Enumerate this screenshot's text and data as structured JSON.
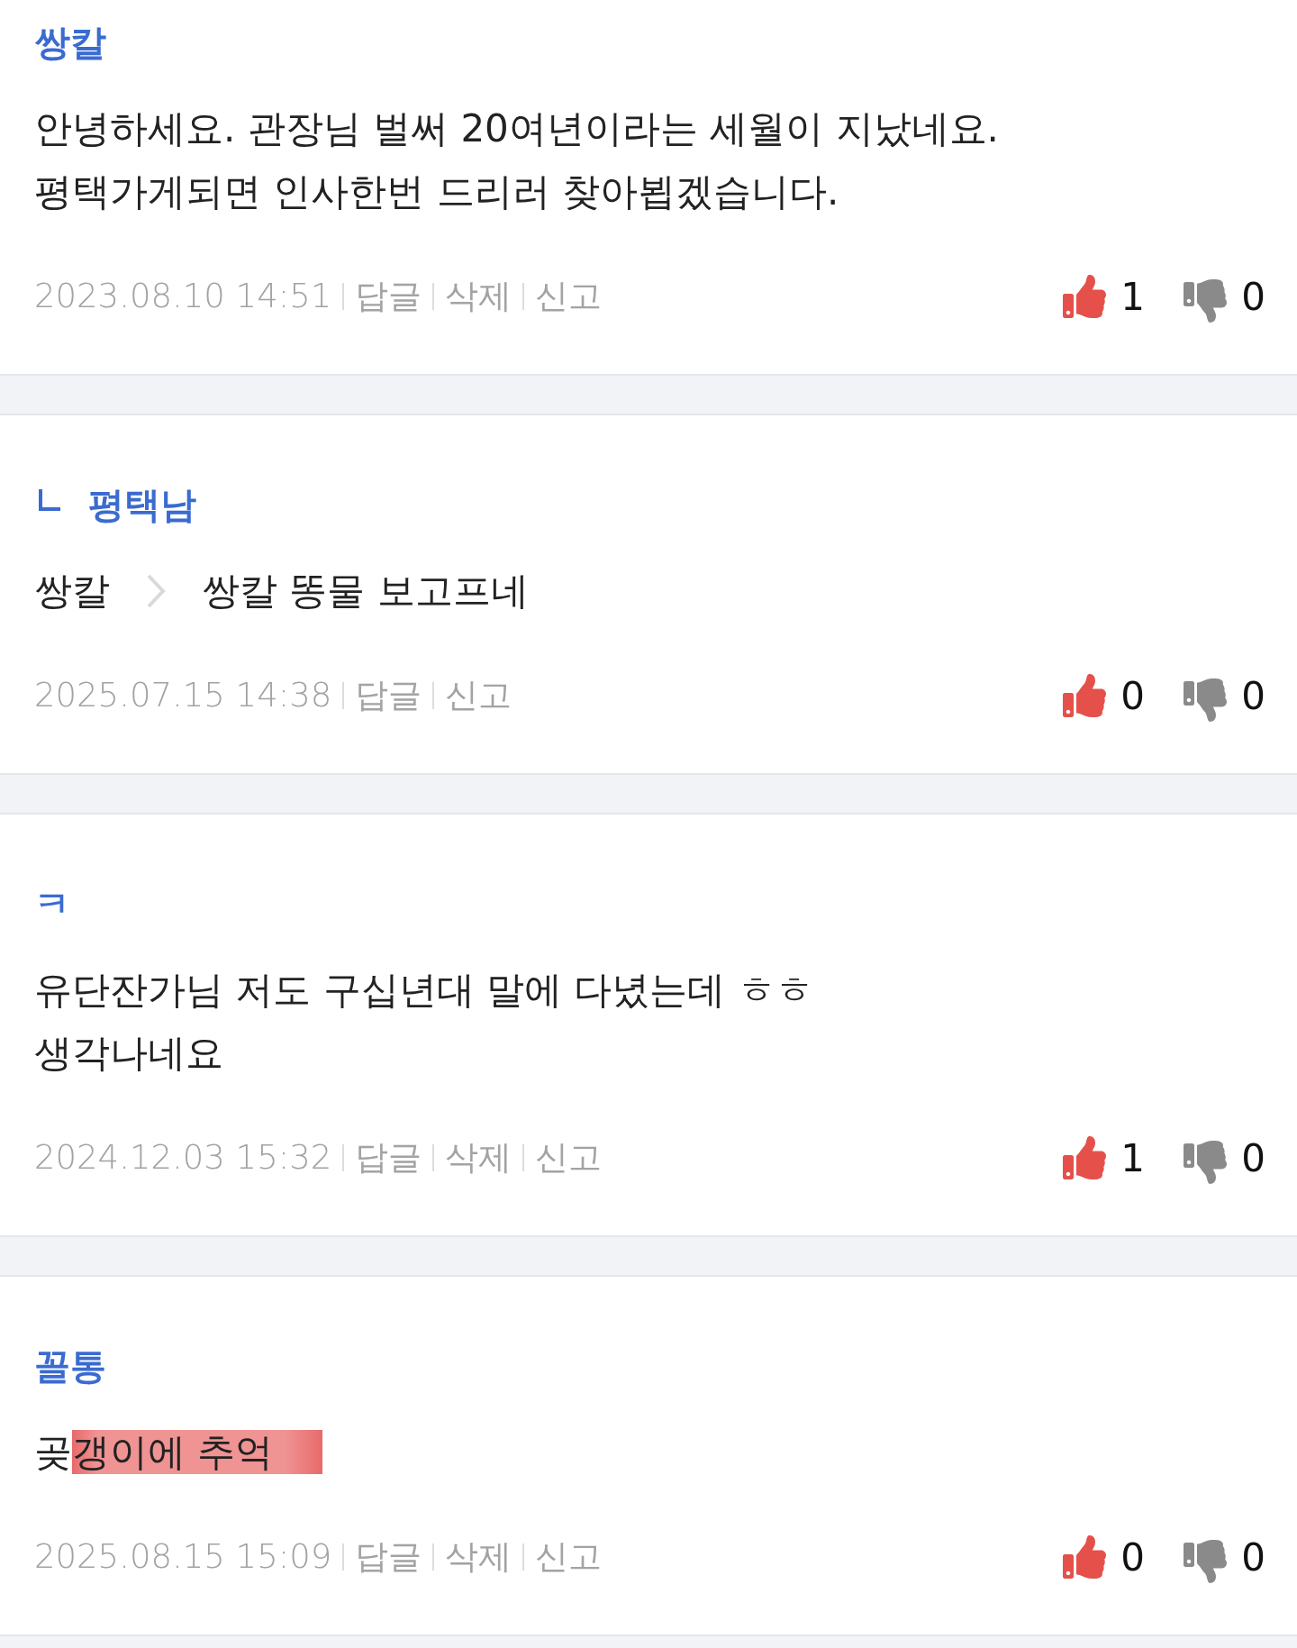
{
  "comments": [
    {
      "author": "쌍칼",
      "is_reply": false,
      "body": [
        [
          {
            "text": "안녕하세요. 관장님 벌써 20여년이라는 세월이 지났네요.",
            "highlighted": false
          }
        ],
        [
          {
            "text": "평택가게되면 인사한번 드리러 찾아뵙겠습니다.",
            "highlighted": false
          }
        ]
      ],
      "date": "2023.08.10 14:51",
      "actions": [
        "답글",
        "삭제",
        "신고"
      ],
      "likes": "1",
      "dislikes": "0"
    },
    {
      "author": "평택남",
      "is_reply": true,
      "mention": "쌍칼",
      "body": [
        [
          {
            "text": "쌍칼 똥물 보고프네",
            "highlighted": false
          }
        ]
      ],
      "date": "2025.07.15 14:38",
      "actions": [
        "답글",
        "신고"
      ],
      "likes": "0",
      "dislikes": "0"
    },
    {
      "author": "ㅋ",
      "is_reply": false,
      "body": [
        [
          {
            "text": "유단잔가님 저도 구십년대 말에 다녔는데 ㅎㅎ",
            "highlighted": false
          }
        ],
        [
          {
            "text": "생각나네요",
            "highlighted": false
          }
        ]
      ],
      "date": "2024.12.03 15:32",
      "actions": [
        "답글",
        "삭제",
        "신고"
      ],
      "likes": "1",
      "dislikes": "0"
    },
    {
      "author": "꼴통",
      "is_reply": false,
      "body": [
        [
          {
            "text": "곶",
            "highlighted": false
          },
          {
            "text": "갱이에 추억",
            "highlighted": true
          }
        ]
      ],
      "date": "2025.08.15 15:09",
      "actions": [
        "답글",
        "삭제",
        "신고"
      ],
      "likes": "0",
      "dislikes": "0"
    }
  ]
}
